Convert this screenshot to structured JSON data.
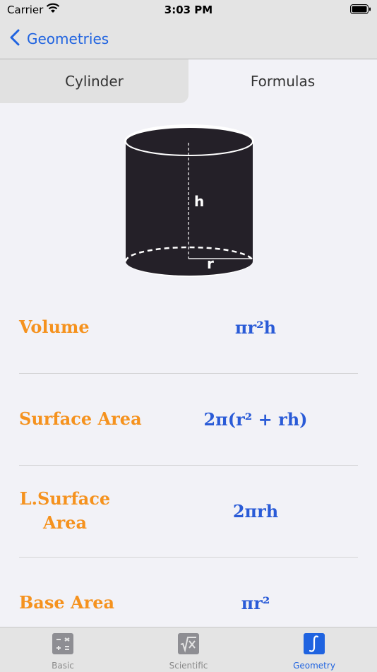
{
  "status_bar": {
    "carrier": "Carrier",
    "time": "3:03 PM"
  },
  "nav": {
    "back_label": "Geometries"
  },
  "segments": {
    "tab1": "Cylinder",
    "tab2": "Formulas"
  },
  "figure": {
    "height_label": "h",
    "radius_label": "r"
  },
  "formulas": [
    {
      "label": "Volume",
      "expr": "πr²h"
    },
    {
      "label": "Surface Area",
      "expr": "2π(r² + rh)"
    },
    {
      "label": "L.Surface Area",
      "expr": "2πrh"
    },
    {
      "label": "Base Area",
      "expr": "πr²"
    }
  ],
  "tabs": [
    {
      "label": "Basic"
    },
    {
      "label": "Scientific"
    },
    {
      "label": "Geometry"
    }
  ],
  "colors": {
    "accent": "#1f63e0",
    "label_orange": "#f5921e",
    "formula_blue": "#2a5bd7",
    "cylinder_fill": "#242028"
  }
}
